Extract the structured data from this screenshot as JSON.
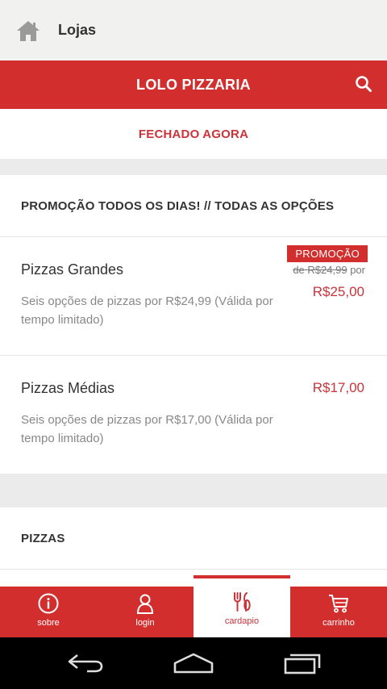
{
  "header": {
    "title": "Lojas",
    "home_icon": "home-icon"
  },
  "store": {
    "name": "LOLO PIZZARIA",
    "status": "FECHADO AGORA",
    "accent": "#d22e2e"
  },
  "sections": [
    {
      "title": "PROMOÇÃO TODOS OS DIAS! // TODAS AS OPÇÕES",
      "items": [
        {
          "name": "Pizzas Grandes",
          "description": "Seis opções de pizzas por R$24,99 (Válida por tempo limitado)",
          "badge": "PROMOÇÃO",
          "old_price_prefix": "de",
          "old_price": "R$24,99",
          "old_price_suffix": "por",
          "price": "R$25,00"
        },
        {
          "name": "Pizzas Médias",
          "description": "Seis opções de pizzas por R$17,00 (Válida por tempo limitado)",
          "price": "R$17,00"
        }
      ]
    },
    {
      "title": "PIZZAS"
    }
  ],
  "bottom_nav": [
    {
      "label": "sobre",
      "icon": "info-icon"
    },
    {
      "label": "login",
      "icon": "user-icon"
    },
    {
      "label": "cardapio",
      "icon": "cutlery-icon",
      "active": true
    },
    {
      "label": "carrinho",
      "icon": "cart-icon"
    }
  ]
}
